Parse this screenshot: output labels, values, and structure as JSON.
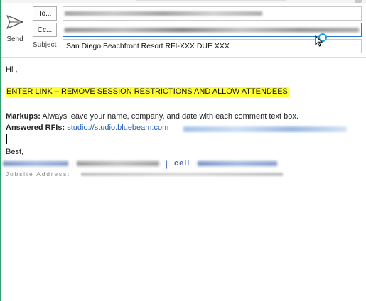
{
  "compose": {
    "send_label": "Send",
    "to_label": "To...",
    "cc_label": "Cc...",
    "subject_label": "Subject",
    "subject_value": "San Diego Beachfront Resort RFI-XXX DUE XXX"
  },
  "message": {
    "greeting": "Hi ,",
    "highlight_text": "ENTER LINK – REMOVE SESSION RESTRICTIONS AND ALLOW ATTENDEES",
    "markups_label": "Markups:",
    "markups_text": " Always leave your name, company, and date with each comment text box.",
    "answered_label": "Answered RFIs:",
    "answered_link": "studio://studio.bluebeam.com",
    "closing": "Best,",
    "signature_separator": "|",
    "signature_cell": "cell",
    "jobsite_label": "Jobsite Address:"
  },
  "colors": {
    "accent_green": "#2fa36b",
    "highlight_yellow": "#ffff33",
    "link_blue": "#1f5fbf",
    "active_field_border": "#2b76c6"
  }
}
